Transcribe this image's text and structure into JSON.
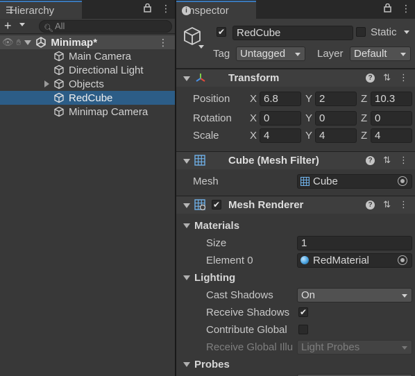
{
  "hierarchy": {
    "tab_label": "Hierarchy",
    "search_placeholder": "All",
    "scene_name": "Minimap*",
    "items": [
      {
        "label": "Main Camera"
      },
      {
        "label": "Directional Light"
      },
      {
        "label": "Objects"
      },
      {
        "label": "RedCube"
      },
      {
        "label": "Minimap Camera"
      }
    ]
  },
  "inspector": {
    "tab_label": "Inspector",
    "object_name": "RedCube",
    "static_label": "Static",
    "tag_label": "Tag",
    "tag_value": "Untagged",
    "layer_label": "Layer",
    "layer_value": "Default",
    "transform": {
      "title": "Transform",
      "position_label": "Position",
      "rotation_label": "Rotation",
      "scale_label": "Scale",
      "axis_x": "X",
      "axis_y": "Y",
      "axis_z": "Z",
      "position": {
        "x": "6.8",
        "y": "2",
        "z": "10.3"
      },
      "rotation": {
        "x": "0",
        "y": "0",
        "z": "0"
      },
      "scale": {
        "x": "4",
        "y": "4",
        "z": "4"
      }
    },
    "mesh_filter": {
      "title": "Cube (Mesh Filter)",
      "mesh_label": "Mesh",
      "mesh_value": "Cube"
    },
    "mesh_renderer": {
      "title": "Mesh Renderer",
      "materials_label": "Materials",
      "size_label": "Size",
      "size_value": "1",
      "element0_label": "Element 0",
      "element0_value": "RedMaterial",
      "lighting_label": "Lighting",
      "cast_shadows_label": "Cast Shadows",
      "cast_shadows_value": "On",
      "receive_shadows_label": "Receive Shadows",
      "contribute_global_label": "Contribute Global",
      "receive_global_label": "Receive Global Illu",
      "receive_global_value": "Light Probes",
      "probes_label": "Probes"
    }
  },
  "colors": {
    "selection": "#2c5d87",
    "tab_accent": "#3a79bb",
    "panel_bg": "#383838",
    "field_bg": "#2a2a2a",
    "material_dot": "#4aa3e0"
  }
}
